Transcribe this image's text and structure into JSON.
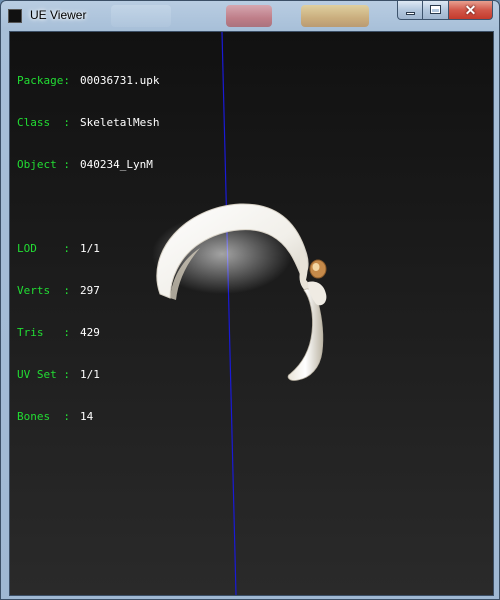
{
  "window": {
    "title": "UE Viewer",
    "controls": {
      "close_glyph": "✕"
    }
  },
  "info": {
    "package": {
      "label": "Package:",
      "value": "00036731.upk"
    },
    "class": {
      "label": "Class  :",
      "value": "SkeletalMesh"
    },
    "object": {
      "label": "Object :",
      "value": "040234_LynM"
    },
    "lod": {
      "label": "LOD    :",
      "value": "1/1"
    },
    "verts": {
      "label": "Verts  :",
      "value": "297"
    },
    "tris": {
      "label": "Tris   :",
      "value": "429"
    },
    "uvset": {
      "label": "UV Set :",
      "value": "1/1"
    },
    "bones": {
      "label": "Bones  :",
      "value": "14"
    }
  },
  "icons": {
    "app": "ue-viewer-app-icon",
    "minimize": "minimize-icon",
    "maximize": "maximize-icon",
    "close": "close-icon"
  },
  "colors": {
    "label_green": "#22dd33",
    "value_white": "#ffffff",
    "axis_blue": "#1a1ad6",
    "viewport_bg": "#1b1b1b"
  }
}
